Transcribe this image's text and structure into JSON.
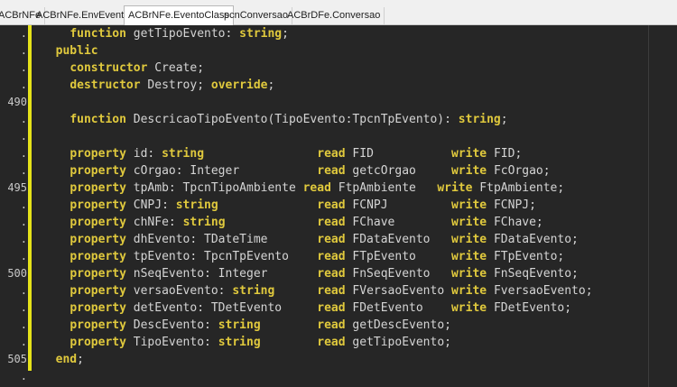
{
  "tabs": [
    {
      "label": "ACBrNFe"
    },
    {
      "label": "ACBrNFe.EnvEvento"
    },
    {
      "label": "ACBrNFe.EventoClass"
    },
    {
      "label": "pcnConversao"
    },
    {
      "label": "ACBrDFe.Conversao"
    }
  ],
  "active_tab": "ACBrNFe.EventoClass",
  "lines": [
    {
      "num": ".",
      "code": [
        {
          "t": "    "
        },
        {
          "k": "function"
        },
        {
          "t": " getTipoEvento: "
        },
        {
          "k": "string"
        },
        {
          "t": ";"
        }
      ]
    },
    {
      "num": ".",
      "code": [
        {
          "t": "  "
        },
        {
          "k": "public"
        }
      ]
    },
    {
      "num": ".",
      "code": [
        {
          "t": "    "
        },
        {
          "k": "constructor"
        },
        {
          "t": " Create;"
        }
      ]
    },
    {
      "num": ".",
      "code": [
        {
          "t": "    "
        },
        {
          "k": "destructor"
        },
        {
          "t": " Destroy; "
        },
        {
          "k": "override"
        },
        {
          "t": ";"
        }
      ]
    },
    {
      "num": "490",
      "code": []
    },
    {
      "num": ".",
      "code": [
        {
          "t": "    "
        },
        {
          "k": "function"
        },
        {
          "t": " DescricaoTipoEvento(TipoEvento:TpcnTpEvento): "
        },
        {
          "k": "string"
        },
        {
          "t": ";"
        }
      ]
    },
    {
      "num": ".",
      "code": []
    },
    {
      "num": ".",
      "code": [
        {
          "t": "    "
        },
        {
          "k": "property"
        },
        {
          "t": " id: "
        },
        {
          "k": "string"
        },
        {
          "t": "                "
        },
        {
          "k": "read"
        },
        {
          "t": " FID           "
        },
        {
          "k": "write"
        },
        {
          "t": " FID;"
        }
      ]
    },
    {
      "num": ".",
      "code": [
        {
          "t": "    "
        },
        {
          "k": "property"
        },
        {
          "t": " cOrgao: Integer           "
        },
        {
          "k": "read"
        },
        {
          "t": " getcOrgao     "
        },
        {
          "k": "write"
        },
        {
          "t": " FcOrgao;"
        }
      ]
    },
    {
      "num": "495",
      "code": [
        {
          "t": "    "
        },
        {
          "k": "property"
        },
        {
          "t": " tpAmb: TpcnTipoAmbiente "
        },
        {
          "k": "read"
        },
        {
          "t": " FtpAmbiente   "
        },
        {
          "k": "write"
        },
        {
          "t": " FtpAmbiente;"
        }
      ]
    },
    {
      "num": ".",
      "code": [
        {
          "t": "    "
        },
        {
          "k": "property"
        },
        {
          "t": " CNPJ: "
        },
        {
          "k": "string"
        },
        {
          "t": "              "
        },
        {
          "k": "read"
        },
        {
          "t": " FCNPJ         "
        },
        {
          "k": "write"
        },
        {
          "t": " FCNPJ;"
        }
      ]
    },
    {
      "num": ".",
      "code": [
        {
          "t": "    "
        },
        {
          "k": "property"
        },
        {
          "t": " chNFe: "
        },
        {
          "k": "string"
        },
        {
          "t": "             "
        },
        {
          "k": "read"
        },
        {
          "t": " FChave        "
        },
        {
          "k": "write"
        },
        {
          "t": " FChave;"
        }
      ]
    },
    {
      "num": ".",
      "code": [
        {
          "t": "    "
        },
        {
          "k": "property"
        },
        {
          "t": " dhEvento: TDateTime       "
        },
        {
          "k": "read"
        },
        {
          "t": " FDataEvento   "
        },
        {
          "k": "write"
        },
        {
          "t": " FDataEvento;"
        }
      ]
    },
    {
      "num": ".",
      "code": [
        {
          "t": "    "
        },
        {
          "k": "property"
        },
        {
          "t": " tpEvento: TpcnTpEvento    "
        },
        {
          "k": "read"
        },
        {
          "t": " FTpEvento     "
        },
        {
          "k": "write"
        },
        {
          "t": " FTpEvento;"
        }
      ]
    },
    {
      "num": "500",
      "code": [
        {
          "t": "    "
        },
        {
          "k": "property"
        },
        {
          "t": " nSeqEvento: Integer       "
        },
        {
          "k": "read"
        },
        {
          "t": " FnSeqEvento   "
        },
        {
          "k": "write"
        },
        {
          "t": " FnSeqEvento;"
        }
      ]
    },
    {
      "num": ".",
      "code": [
        {
          "t": "    "
        },
        {
          "k": "property"
        },
        {
          "t": " versaoEvento: "
        },
        {
          "k": "string"
        },
        {
          "t": "      "
        },
        {
          "k": "read"
        },
        {
          "t": " FVersaoEvento "
        },
        {
          "k": "write"
        },
        {
          "t": " FversaoEvento;"
        }
      ]
    },
    {
      "num": ".",
      "code": [
        {
          "t": "    "
        },
        {
          "k": "property"
        },
        {
          "t": " detEvento: TDetEvento     "
        },
        {
          "k": "read"
        },
        {
          "t": " FDetEvento    "
        },
        {
          "k": "write"
        },
        {
          "t": " FDetEvento;"
        }
      ]
    },
    {
      "num": ".",
      "code": [
        {
          "t": "    "
        },
        {
          "k": "property"
        },
        {
          "t": " DescEvento: "
        },
        {
          "k": "string"
        },
        {
          "t": "        "
        },
        {
          "k": "read"
        },
        {
          "t": " getDescEvento;"
        }
      ]
    },
    {
      "num": ".",
      "code": [
        {
          "t": "    "
        },
        {
          "k": "property"
        },
        {
          "t": " TipoEvento: "
        },
        {
          "k": "string"
        },
        {
          "t": "        "
        },
        {
          "k": "read"
        },
        {
          "t": " getTipoEvento;"
        }
      ]
    },
    {
      "num": "505",
      "code": [
        {
          "t": "  "
        },
        {
          "k": "end"
        },
        {
          "t": ";"
        }
      ]
    },
    {
      "num": ".",
      "code": []
    }
  ],
  "colors": {
    "keyword": "#e0c93d",
    "text": "#d4d4d4",
    "background": "#262626",
    "change_bar": "#e5e21a"
  }
}
